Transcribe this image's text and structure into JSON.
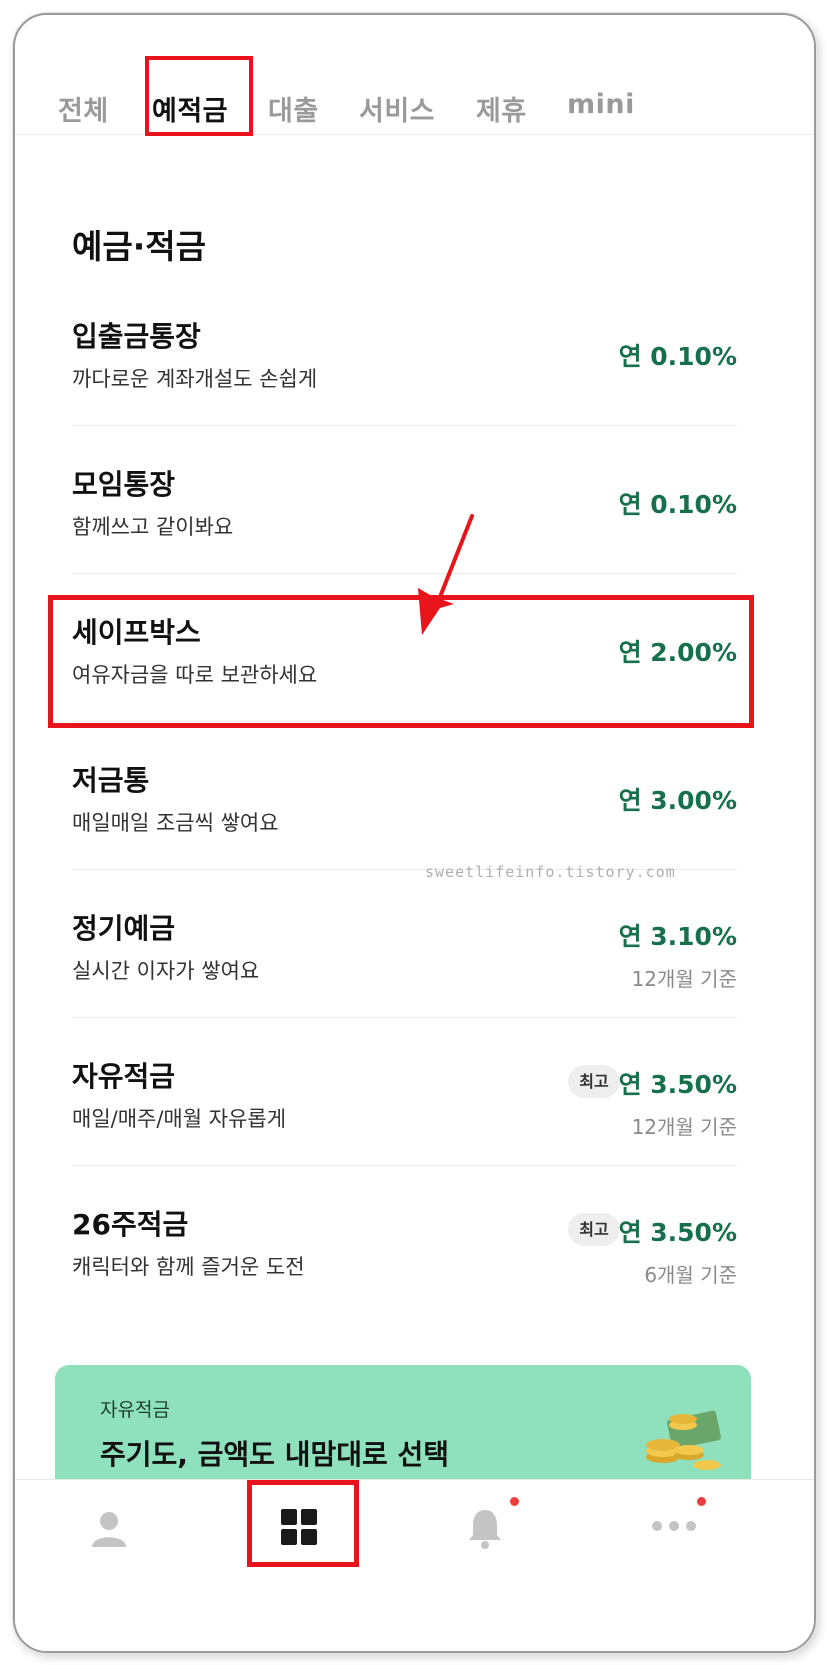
{
  "tabs": [
    {
      "label": "전체"
    },
    {
      "label": "예적금"
    },
    {
      "label": "대출"
    },
    {
      "label": "서비스"
    },
    {
      "label": "제휴"
    },
    {
      "label": "mini"
    }
  ],
  "section_title": "예금·적금",
  "products": [
    {
      "name": "입출금통장",
      "desc": "까다로운 계좌개설도 손쉽게",
      "rate": "연 0.10%"
    },
    {
      "name": "모임통장",
      "desc": "함께쓰고 같이봐요",
      "rate": "연 0.10%"
    },
    {
      "name": "세이프박스",
      "desc": "여유자금을 따로 보관하세요",
      "rate": "연 2.00%"
    },
    {
      "name": "저금통",
      "desc": "매일매일 조금씩 쌓여요",
      "rate": "연 3.00%"
    },
    {
      "name": "정기예금",
      "desc": "실시간 이자가 쌓여요",
      "rate": "연 3.10%",
      "basis": "12개월 기준"
    },
    {
      "name": "자유적금",
      "desc": "매일/매주/매월 자유롭게",
      "rate": "연 3.50%",
      "basis": "12개월 기준",
      "badge": "최고"
    },
    {
      "name": "26주적금",
      "desc": "캐릭터와 함께 즐거운 도전",
      "rate": "연 3.50%",
      "basis": "6개월 기준",
      "badge": "최고"
    }
  ],
  "watermark": "sweetlifeinfo.tistory.com",
  "banner": {
    "sub": "자유적금",
    "headline": "주기도, 금액도 내맘대로 선택"
  },
  "colors": {
    "rate_green": "#15704b",
    "banner_bg": "#8fe0bd",
    "highlight_red": "#e8141b"
  },
  "nav_icons": [
    "person-icon",
    "grid-icon",
    "bell-icon",
    "more-icon"
  ]
}
